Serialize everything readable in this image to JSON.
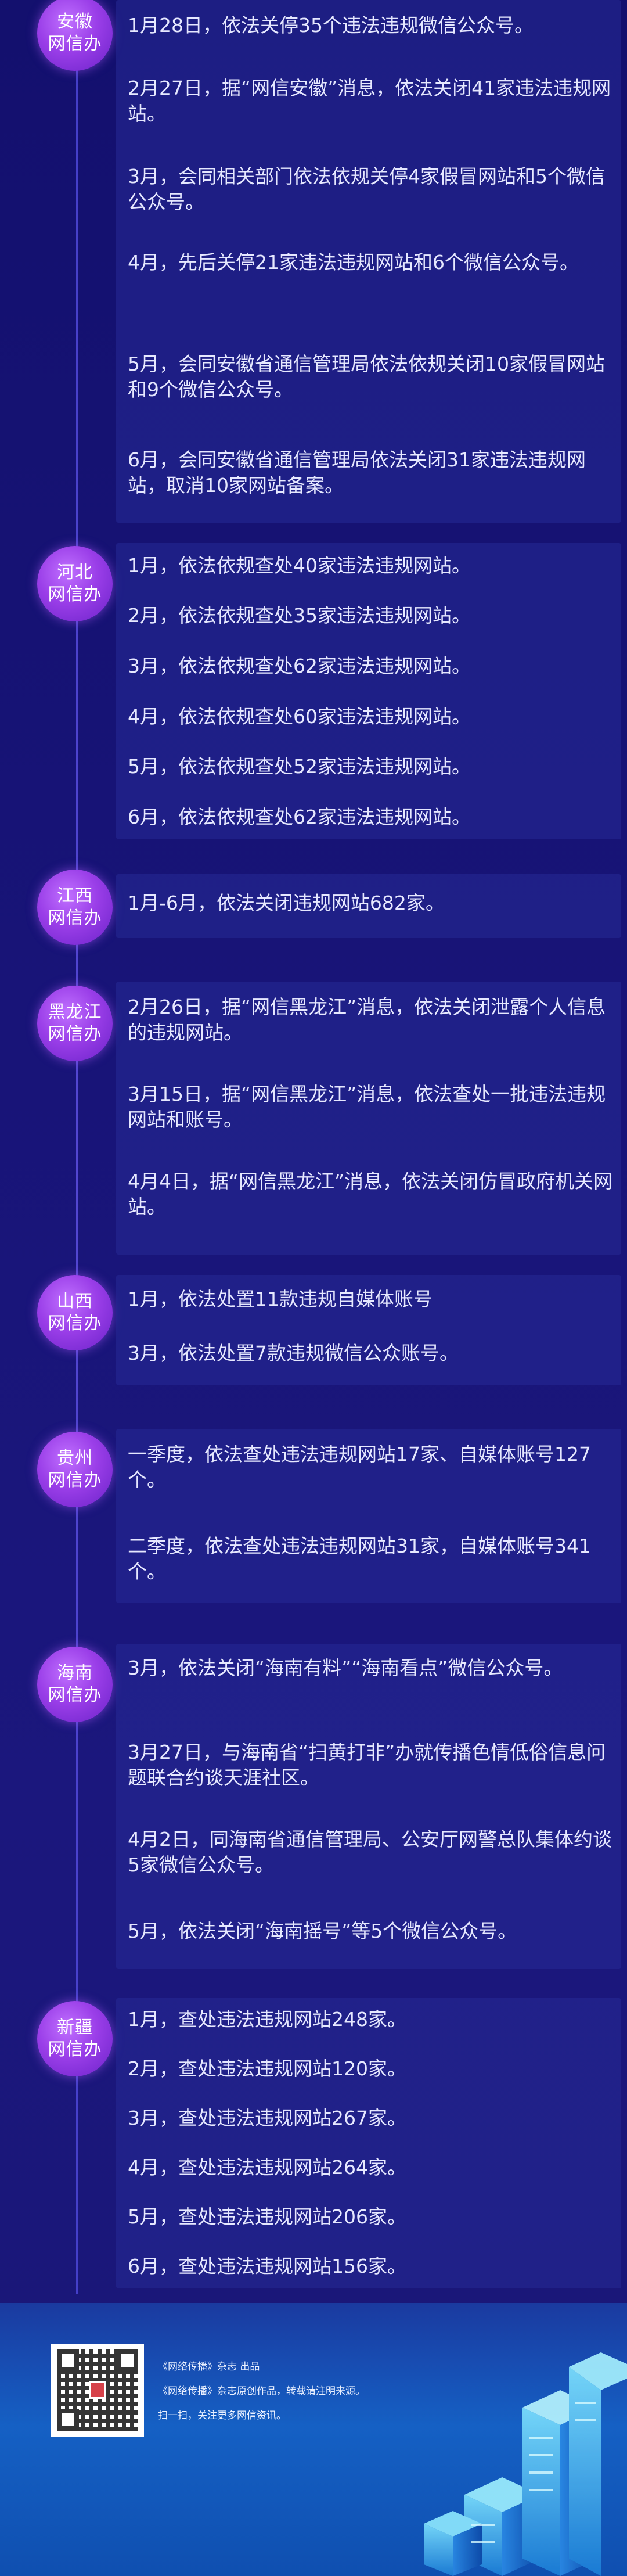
{
  "sections": [
    {
      "badge": [
        "安徽",
        "网信办"
      ],
      "items": [
        "1月28日，依法关停35个违法违规微信公众号。",
        "2月27日，据“网信安徽”消息，依法关闭41家违法违规网站。",
        "3月，会同相关部门依法依规关停4家假冒网站和5个微信公众号。",
        "4月，先后关停21家违法违规网站和6个微信公众号。",
        "5月，会同安徽省通信管理局依法依规关闭10家假冒网站和9个微信公众号。",
        "6月，会同安徽省通信管理局依法关闭31家违法违规网站，取消10家网站备案。"
      ]
    },
    {
      "badge": [
        "河北",
        "网信办"
      ],
      "items": [
        "1月，依法依规查处40家违法违规网站。",
        "2月，依法依规查处35家违法违规网站。",
        "3月，依法依规查处62家违法违规网站。",
        "4月，依法依规查处60家违法违规网站。",
        "5月，依法依规查处52家违法违规网站。",
        "6月，依法依规查处62家违法违规网站。"
      ]
    },
    {
      "badge": [
        "江西",
        "网信办"
      ],
      "items": [
        "1月-6月，依法关闭违规网站682家。"
      ]
    },
    {
      "badge": [
        "黑龙江",
        "网信办"
      ],
      "items": [
        "2月26日，据“网信黑龙江”消息，依法关闭泄露个人信息的违规网站。",
        "3月15日，据“网信黑龙江”消息，依法查处一批违法违规网站和账号。",
        "4月4日，据“网信黑龙江”消息，依法关闭仿冒政府机关网站。"
      ]
    },
    {
      "badge": [
        "山西",
        "网信办"
      ],
      "items": [
        "1月，依法处置11款违规自媒体账号",
        "3月，依法处置7款违规微信公众账号。"
      ]
    },
    {
      "badge": [
        "贵州",
        "网信办"
      ],
      "items": [
        "一季度，依法查处违法违规网站17家、自媒体账号127个。",
        "二季度，依法查处违法违规网站31家，自媒体账号341个。"
      ]
    },
    {
      "badge": [
        "海南",
        "网信办"
      ],
      "items": [
        "3月，依法关闭“海南有料”“海南看点”微信公众号。",
        "3月27日，与海南省“扫黄打非”办就传播色情低俗信息问题联合约谈天涯社区。",
        "4月2日，同海南省通信管理局、公安厅网警总队集体约谈5家微信公众号。",
        "5月，依法关闭“海南摇号”等5个微信公众号。"
      ]
    },
    {
      "badge": [
        "新疆",
        "网信办"
      ],
      "items": [
        "1月，查处违法违规网站248家。",
        "2月，查处违法违规网站120家。",
        "3月，查处违法违规网站267家。",
        "4月，查处违法违规网站264家。",
        "5月，查处违法违规网站206家。",
        "6月，查处违法违规网站156家。"
      ]
    }
  ],
  "footer": {
    "line1": "《网络传播》杂志 出品",
    "line2": "《网络传播》杂志原创作品，转载请注明来源。",
    "line3": "扫一扫，关注更多网信资讯。"
  },
  "colors": {
    "background": "#16127a",
    "badge": "#9a3ee8",
    "panel": "#262a96",
    "text": "#e6e8ff",
    "footer": "#1560c4"
  }
}
